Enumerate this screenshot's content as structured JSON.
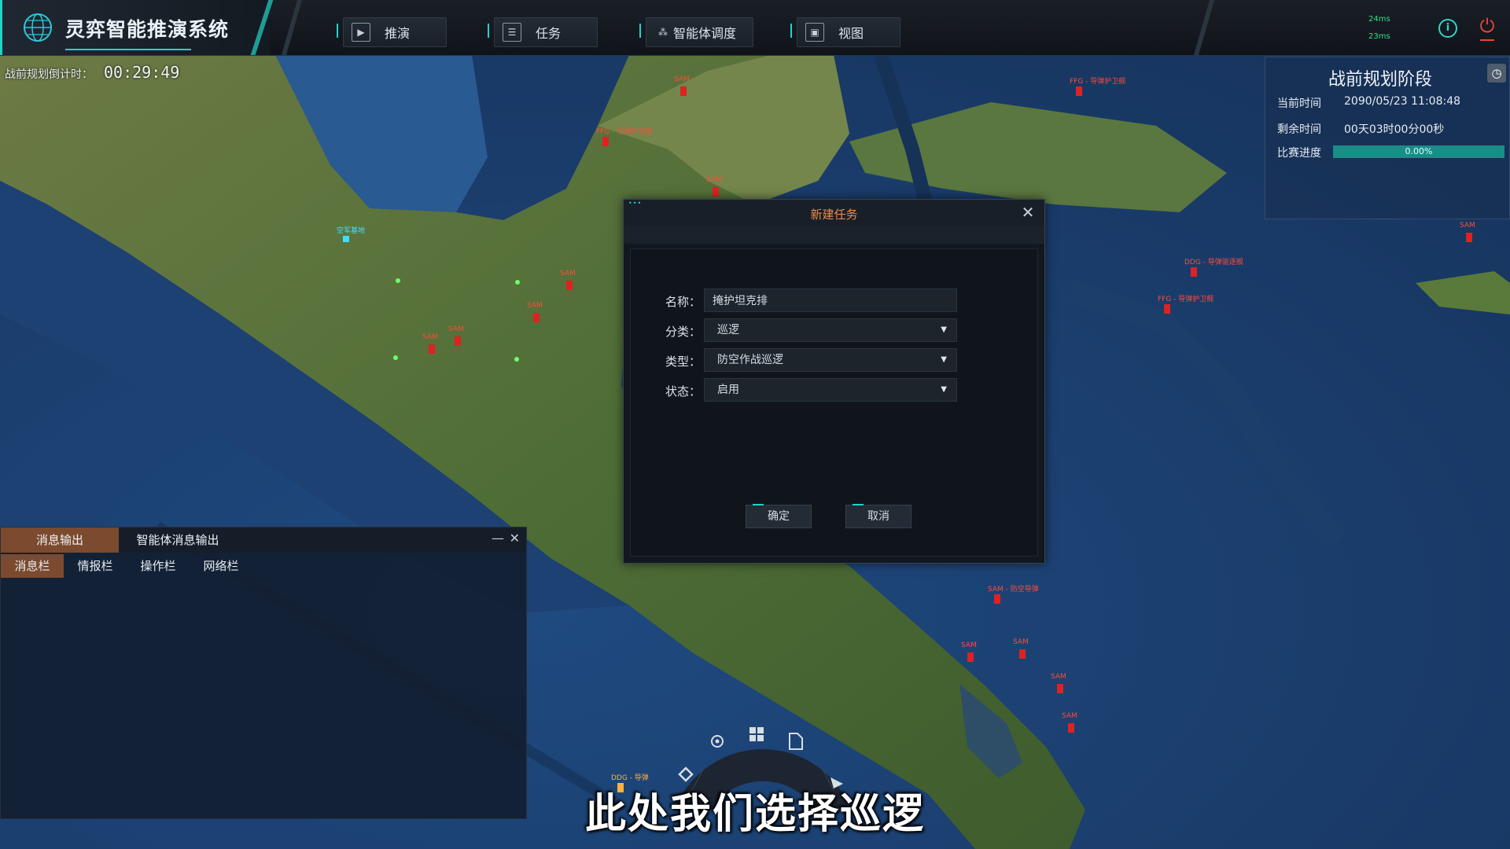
{
  "app": {
    "title": "灵弈智能推演系统"
  },
  "nav": [
    {
      "label": "推演",
      "icon": "deduction-icon"
    },
    {
      "label": "任务",
      "icon": "task-icon"
    },
    {
      "label": "智能体调度",
      "icon": "agent-schedule-icon"
    },
    {
      "label": "视图",
      "icon": "view-icon"
    }
  ],
  "status": {
    "ping_top": "24ms",
    "ping_bottom": "23ms"
  },
  "countdown": {
    "label": "战前规划倒计时：",
    "value": "00:29:49"
  },
  "phase": {
    "title": "战前规划阶段",
    "current_time_label": "当前时间",
    "current_time": "2090/05/23 11:08:48",
    "remaining_label": "剩余时间",
    "remaining": "00天03时00分00秒",
    "progress_label": "比赛进度",
    "progress_text": "0.00%",
    "progress_value": 0.0
  },
  "dialog": {
    "title": "新建任务",
    "name_label": "名称：",
    "name_value": "掩护坦克排",
    "category_label": "分类：",
    "category_value": "巡逻",
    "type_label": "类型：",
    "type_value": "防空作战巡逻",
    "state_label": "状态：",
    "state_value": "启用",
    "confirm": "确定",
    "cancel": "取消"
  },
  "messages": {
    "tabs": [
      "消息输出",
      "智能体消息输出"
    ],
    "subtabs": [
      "消息栏",
      "情报栏",
      "操作栏",
      "网络栏"
    ],
    "minimize": "—",
    "close": "✕"
  },
  "subtitle": "此处我们选择巡逻",
  "colors": {
    "accent": "#23d3c8",
    "active_tab": "#7c4a2e",
    "dialog_title": "#f08a4b",
    "power": "#e8453c"
  }
}
